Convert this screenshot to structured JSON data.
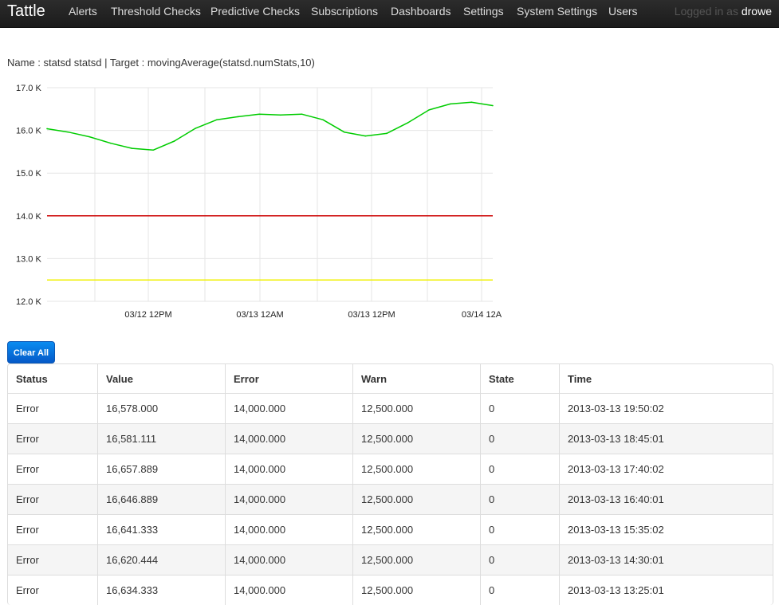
{
  "nav": {
    "brand": "Tattle",
    "items": [
      "Alerts",
      "Threshold Checks",
      "Predictive Checks",
      "Subscriptions",
      "Dashboards",
      "Settings",
      "System Settings",
      "Users"
    ],
    "logged_in_label": "Logged in as",
    "username": "drowe"
  },
  "caption": "Name : statsd statsd | Target : movingAverage(statsd.numStats,10)",
  "colors": {
    "series": "#00cc00",
    "error_line": "#cc0000",
    "warn_line": "#f0f000",
    "button": "#0a7ad8"
  },
  "chart_data": {
    "type": "line",
    "title": "",
    "xlabel": "",
    "ylabel": "",
    "ylim": [
      12000,
      17000
    ],
    "y_ticks": [
      "12.0 K",
      "13.0 K",
      "14.0 K",
      "15.0 K",
      "16.0 K",
      "17.0 K"
    ],
    "x_ticks": [
      "03/12 12PM",
      "03/13 12AM",
      "03/13 12PM",
      "03/14 12A"
    ],
    "grid": true,
    "series": [
      {
        "x": [
          "03/12 08AM",
          "03/12 10AM",
          "03/12 11AM",
          "03/12 12PM",
          "03/12 01PM",
          "03/12 02PM",
          "03/12 04PM",
          "03/12 06PM",
          "03/12 08PM",
          "03/12 10PM",
          "03/13 12AM",
          "03/13 02AM",
          "03/13 04AM",
          "03/13 06AM",
          "03/13 08AM",
          "03/13 09AM",
          "03/13 10AM",
          "03/13 12PM",
          "03/13 02PM",
          "03/13 04PM",
          "03/13 06PM",
          "03/13 08PM"
        ],
        "values": [
          16040,
          15960,
          15850,
          15700,
          15580,
          15540,
          15750,
          16050,
          16250,
          16320,
          16380,
          16360,
          16380,
          16250,
          15960,
          15870,
          15930,
          16180,
          16480,
          16620,
          16660,
          16580
        ]
      },
      {
        "values": [
          14000,
          14000
        ]
      },
      {
        "values": [
          12500,
          12500
        ]
      }
    ]
  },
  "table": {
    "clear_button": "Clear All",
    "headers": [
      "Status",
      "Value",
      "Error",
      "Warn",
      "State",
      "Time"
    ],
    "rows": [
      [
        "Error",
        "16,578.000",
        "14,000.000",
        "12,500.000",
        "0",
        "2013-03-13 19:50:02"
      ],
      [
        "Error",
        "16,581.111",
        "14,000.000",
        "12,500.000",
        "0",
        "2013-03-13 18:45:01"
      ],
      [
        "Error",
        "16,657.889",
        "14,000.000",
        "12,500.000",
        "0",
        "2013-03-13 17:40:02"
      ],
      [
        "Error",
        "16,646.889",
        "14,000.000",
        "12,500.000",
        "0",
        "2013-03-13 16:40:01"
      ],
      [
        "Error",
        "16,641.333",
        "14,000.000",
        "12,500.000",
        "0",
        "2013-03-13 15:35:02"
      ],
      [
        "Error",
        "16,620.444",
        "14,000.000",
        "12,500.000",
        "0",
        "2013-03-13 14:30:01"
      ],
      [
        "Error",
        "16,634.333",
        "14,000.000",
        "12,500.000",
        "0",
        "2013-03-13 13:25:01"
      ]
    ]
  }
}
